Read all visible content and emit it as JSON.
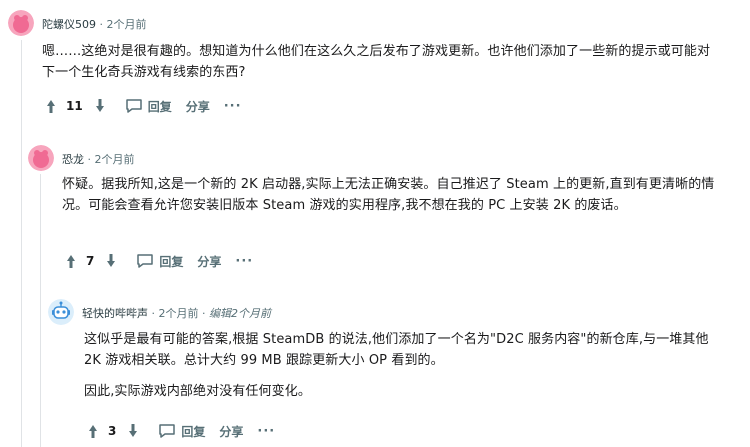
{
  "comments": [
    {
      "author": "陀螺仪509",
      "separator": "·",
      "time": "2个月前",
      "text": [
        "嗯……这绝对是很有趣的。想知道为什么他们在这么久之后发布了游戏更新。也许他们添加了一些新的提示或可能对下一个生化奇兵游戏有线索的东西?"
      ],
      "score": "11",
      "reply_label": "回复",
      "share_label": "分享",
      "more_label": "···",
      "avatar_color": "#f47ca0"
    },
    {
      "author": "恐龙",
      "separator": "·",
      "time": "2个月前",
      "text": [
        "怀疑。据我所知,这是一个新的 2K 启动器,实际上无法正确安装。自己推迟了 Steam 上的更新,直到有更清晰的情况。可能会查看允许您安装旧版本 Steam 游戏的实用程序,我不想在我的 PC 上安装 2K 的废话。"
      ],
      "score": "7",
      "reply_label": "回复",
      "share_label": "分享",
      "more_label": "···",
      "avatar_color": "#f47ca0"
    },
    {
      "author": "轻快的哔哔声",
      "separator": "·",
      "time": "2个月前",
      "edited": "编辑2个月前",
      "text": [
        "这似乎是最有可能的答案,根据 SteamDB 的说法,他们添加了一个名为\"D2C 服务内容\"的新仓库,与一堆其他 2K 游戏相关联。总计大约 99 MB 跟踪更新大小 OP 看到的。",
        "因此,实际游戏内部绝对没有任何变化。"
      ],
      "score": "3",
      "reply_label": "回复",
      "share_label": "分享",
      "more_label": "···",
      "avatar_color": "#d7eaf8"
    }
  ]
}
